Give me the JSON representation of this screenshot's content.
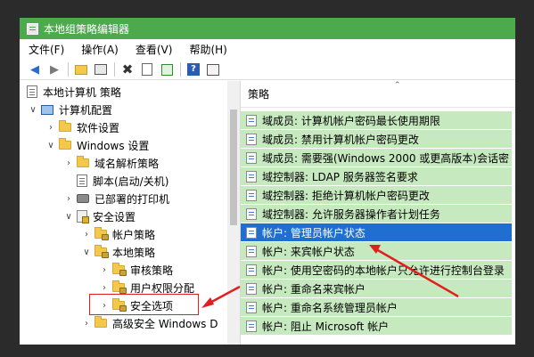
{
  "window": {
    "title": "本地组策略编辑器"
  },
  "menu": [
    {
      "label": "文件(F)"
    },
    {
      "label": "操作(A)"
    },
    {
      "label": "查看(V)"
    },
    {
      "label": "帮助(H)"
    }
  ],
  "toolbar": {
    "buttons": [
      "back-icon",
      "forward-icon",
      "up-folder-icon",
      "show-tree-icon",
      "delete-icon",
      "properties-icon",
      "export-icon",
      "help-icon",
      "view-icon"
    ]
  },
  "tree": {
    "items": [
      {
        "label": "本地计算机 策略",
        "icon": "doc-icon"
      },
      {
        "label": "计算机配置",
        "icon": "computer-icon"
      },
      {
        "label": "软件设置",
        "icon": "folder-icon"
      },
      {
        "label": "Windows 设置",
        "icon": "folder-icon"
      },
      {
        "label": "域名解析策略",
        "icon": "folder-icon"
      },
      {
        "label": "脚本(启动/关机)",
        "icon": "doc-icon"
      },
      {
        "label": "已部署的打印机",
        "icon": "printer-icon"
      },
      {
        "label": "安全设置",
        "icon": "security-icon"
      },
      {
        "label": "帐户策略",
        "icon": "lock-folder-icon"
      },
      {
        "label": "本地策略",
        "icon": "lock-folder-icon"
      },
      {
        "label": "审核策略",
        "icon": "lock-folder-icon"
      },
      {
        "label": "用户权限分配",
        "icon": "lock-folder-icon"
      },
      {
        "label": "安全选项",
        "icon": "lock-folder-icon"
      },
      {
        "label": "高级安全 Windows D",
        "icon": "folder-icon"
      }
    ]
  },
  "list": {
    "header": "策略",
    "rows": [
      {
        "label": "域成员: 计算机帐户密码最长使用期限"
      },
      {
        "label": "域成员: 禁用计算机帐户密码更改"
      },
      {
        "label": "域成员: 需要强(Windows 2000 或更高版本)会话密"
      },
      {
        "label": "域控制器: LDAP 服务器签名要求"
      },
      {
        "label": "域控制器: 拒绝计算机帐户密码更改"
      },
      {
        "label": "域控制器: 允许服务器操作者计划任务"
      },
      {
        "label": "帐户: 管理员帐户状态",
        "selected": true
      },
      {
        "label": "帐户: 来宾帐户状态"
      },
      {
        "label": "帐户: 使用空密码的本地帐户只允许进行控制台登录"
      },
      {
        "label": "帐户: 重命名来宾帐户"
      },
      {
        "label": "帐户: 重命名系统管理员帐户"
      },
      {
        "label": "帐户: 阻止 Microsoft 帐户"
      }
    ]
  },
  "colors": {
    "titlebar": "#4ca94c",
    "row_bg": "#c7e9c0",
    "selected": "#1e6fd0",
    "annotation": "#e02020"
  }
}
